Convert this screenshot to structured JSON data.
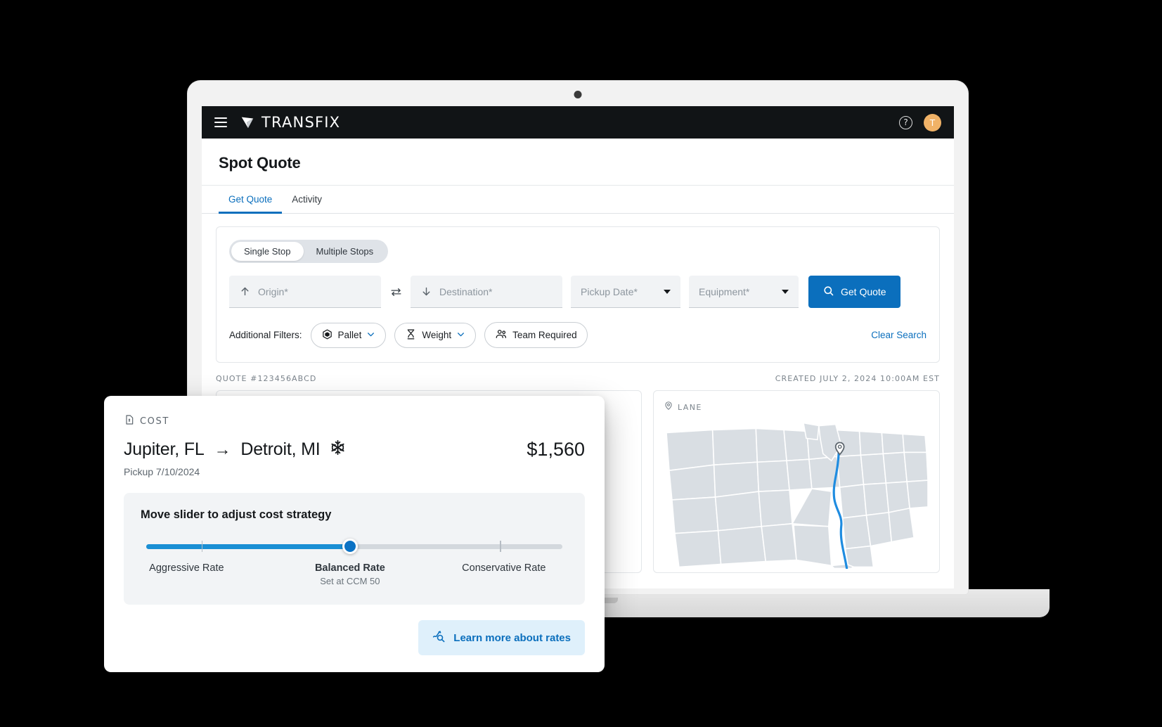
{
  "app": {
    "brand_name": "TRANSFIX",
    "brand_mark_icon": "transfix-logo-icon",
    "menu_icon": "hamburger-menu-icon",
    "help_icon": "help-circle-icon",
    "avatar_initial": "T"
  },
  "page": {
    "title": "Spot Quote"
  },
  "tabs": [
    {
      "label": "Get Quote",
      "active": true
    },
    {
      "label": "Activity",
      "active": false
    }
  ],
  "search": {
    "stop_toggle": [
      {
        "label": "Single Stop",
        "active": true
      },
      {
        "label": "Multiple Stops",
        "active": false
      }
    ],
    "origin": {
      "placeholder": "Origin*",
      "value": "",
      "icon": "arrow-up-icon"
    },
    "destination": {
      "placeholder": "Destination*",
      "value": "",
      "icon": "arrow-down-icon"
    },
    "swap_icon": "swap-horizontal-icon",
    "pickup_date": {
      "placeholder": "Pickup Date*",
      "value": ""
    },
    "equipment": {
      "placeholder": "Equipment*",
      "value": ""
    },
    "get_quote_label": "Get Quote",
    "get_quote_icon": "search-icon",
    "filters_label": "Additional Filters:",
    "filters": [
      {
        "label": "Pallet",
        "icon": "pallet-icon",
        "has_caret": true
      },
      {
        "label": "Weight",
        "icon": "weight-scale-icon",
        "has_caret": true
      },
      {
        "label": "Team Required",
        "icon": "team-people-icon",
        "has_caret": false
      }
    ],
    "clear_search_label": "Clear Search"
  },
  "quote": {
    "id_label": "QUOTE #123456ABCD",
    "created_label": "CREATED JULY 2, 2024 10:00AM EST"
  },
  "lane": {
    "label": "LANE",
    "icon": "map-pin-icon",
    "destination_marker": "map-marker-detroit"
  },
  "cost_card": {
    "section_label": "COST",
    "section_icon": "cost-document-icon",
    "origin_city": "Jupiter, FL",
    "route_arrow": "→",
    "destination_city": "Detroit, MI",
    "equipment_icon": "snowflake-reefer-icon",
    "price": "$1,560",
    "pickup_text": "Pickup 7/10/2024",
    "slider": {
      "title": "Move slider to adjust cost strategy",
      "value_percent": 49,
      "labels": {
        "left": "Aggressive Rate",
        "middle": "Balanced Rate",
        "middle_sub": "Set at CCM 50",
        "right": "Conservative Rate"
      }
    },
    "learn_more_label": "Learn more about rates",
    "learn_more_icon": "rate-analytics-search-icon"
  },
  "colors": {
    "brand_dark": "#111416",
    "accent_blue": "#0b6fbd",
    "slider_blue": "#1a8fd4",
    "avatar_orange": "#f0b267",
    "map_land": "#d9dee3",
    "route_blue": "#1f8ce0"
  }
}
